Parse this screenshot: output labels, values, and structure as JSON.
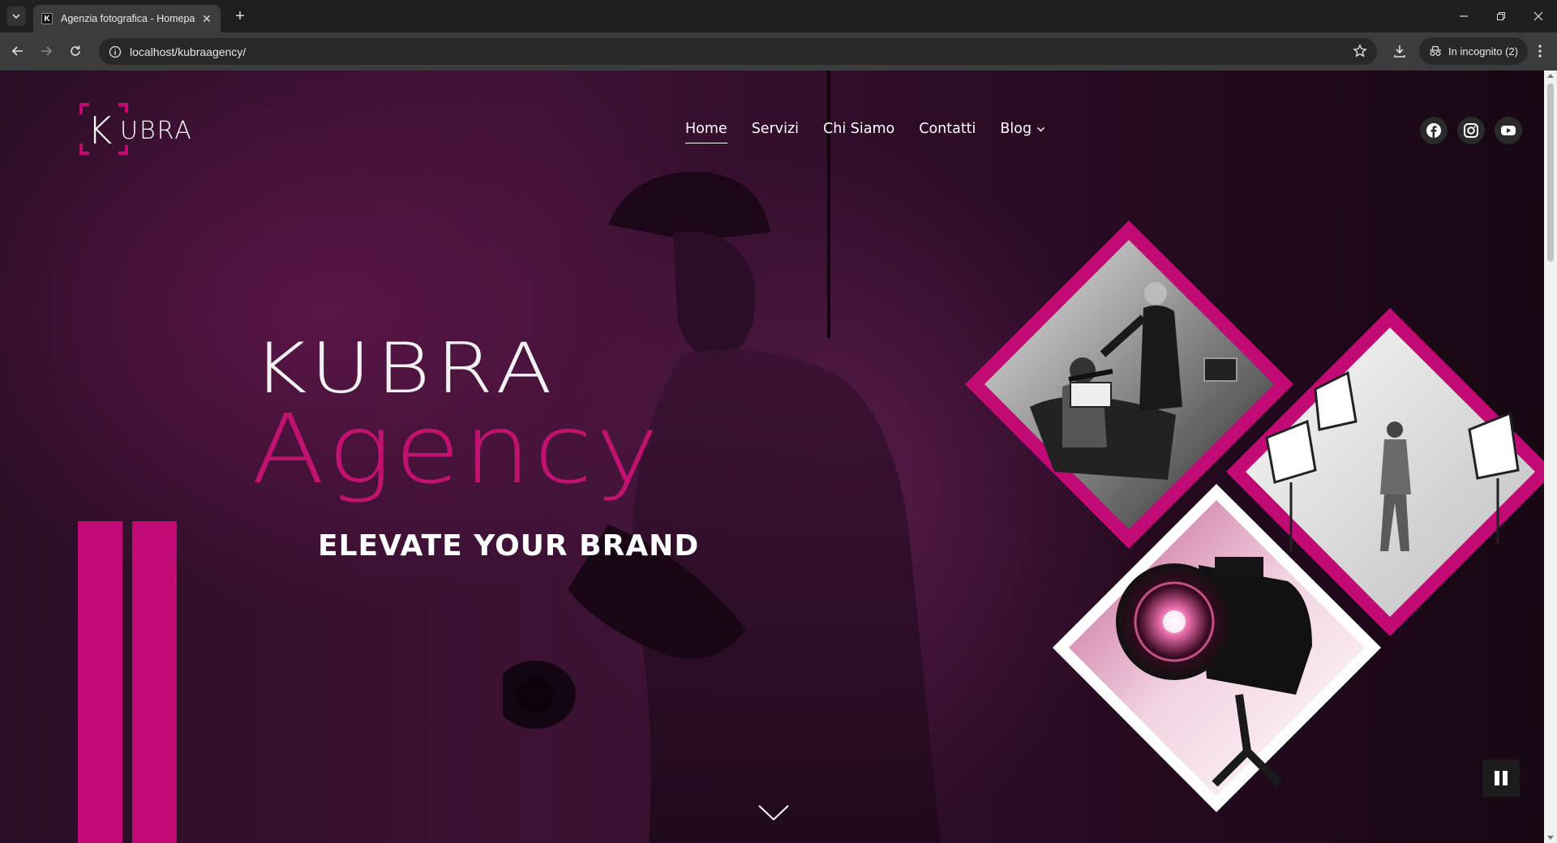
{
  "browser": {
    "tab_title": "Agenzia fotografica - Homepage",
    "url": "localhost/kubraagency/",
    "incognito_label": "In incognito (2)"
  },
  "site": {
    "logo_text": "KUBRA",
    "nav": [
      {
        "label": "Home",
        "active": true
      },
      {
        "label": "Servizi",
        "active": false
      },
      {
        "label": "Chi Siamo",
        "active": false
      },
      {
        "label": "Contatti",
        "active": false
      },
      {
        "label": "Blog",
        "active": false,
        "has_dropdown": true
      }
    ],
    "social": [
      "facebook-icon",
      "instagram-icon",
      "youtube-icon"
    ],
    "hero": {
      "title": "KUBRA",
      "subtitle": "Agency",
      "tagline": "ELEVATE YOUR BRAND"
    }
  },
  "colors": {
    "accent": "#c20a75",
    "background": "#2a0d24",
    "text": "#ffffff"
  }
}
